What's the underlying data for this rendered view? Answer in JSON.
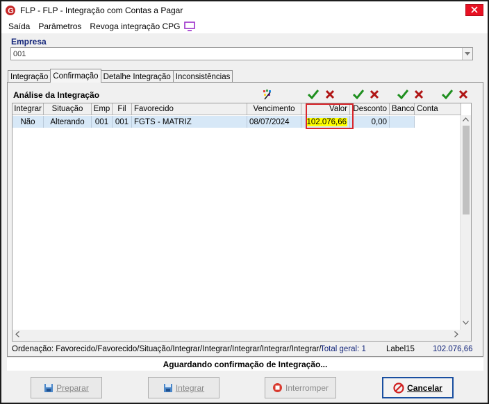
{
  "window": {
    "title": "FLP -  FLP - Integração com Contas a Pagar"
  },
  "menu": {
    "items": [
      "Saída",
      "Parâmetros",
      "Revoga integração CPG"
    ]
  },
  "empresa": {
    "label": "Empresa",
    "value": "001"
  },
  "tabs": [
    "Integração",
    "Confirmação",
    "Detalhe Integração",
    "Inconsistências"
  ],
  "active_tab": "Confirmação",
  "panel": {
    "title": "Análise da Integração"
  },
  "grid": {
    "columns": [
      "Integrar",
      "Situação",
      "Emp",
      "Fil",
      "Favorecido",
      "Vencimento",
      "Valor",
      "Desconto",
      "Banco",
      "Conta"
    ],
    "rows": [
      {
        "integrar": "Não",
        "situacao": "Alterando",
        "emp": "001",
        "fil": "001",
        "favorecido": "FGTS - MATRIZ",
        "vencimento": "08/07/2024",
        "valor": "102.076,66",
        "desconto": "0,00",
        "banco": "",
        "conta": ""
      }
    ]
  },
  "footer": {
    "ordenacao": "Ordenação: Favorecido/Favorecido/Situação/Integrar/Integrar/Integrar/Integrar/Integrar/Int",
    "total_label": "Total geral: 1",
    "label15": "Label15",
    "total_value": "102.076,66"
  },
  "status": "Aguardando confirmação de Integração...",
  "buttons": {
    "preparar": "Preparar",
    "integrar": "Integrar",
    "interromper": "Interromper",
    "cancelar": "Cancelar"
  },
  "colors": {
    "accent_blue": "#13257a",
    "check_green": "#1f8f1f",
    "cross_red": "#b01515",
    "highlight": "#ffff00",
    "selection_row": "#d7e8f7"
  },
  "icons": [
    "app-logo-icon",
    "close-icon",
    "monitor-icon",
    "dropdown-arrow-icon",
    "color-wand-icon",
    "check-icon",
    "cross-icon",
    "save-disk-icon",
    "stop-icon",
    "cancel-icon"
  ]
}
